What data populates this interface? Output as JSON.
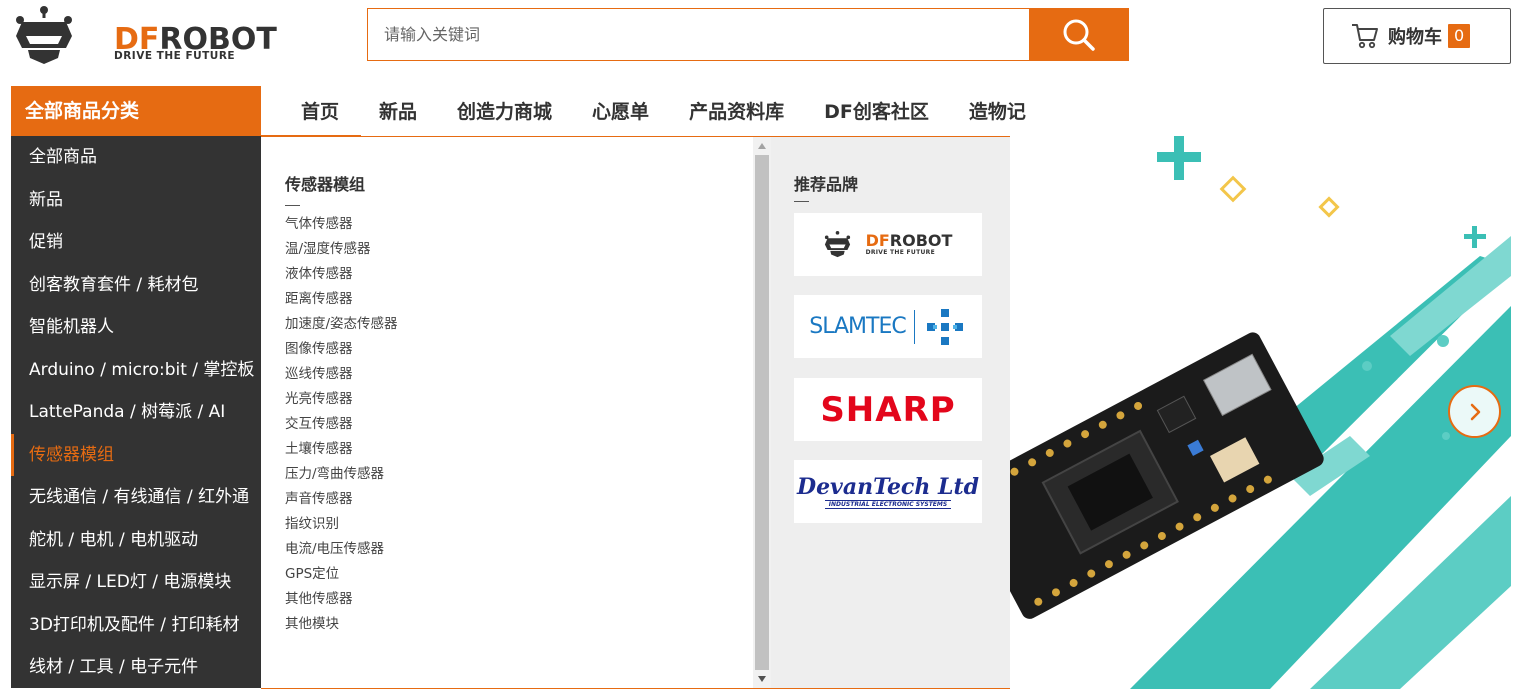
{
  "logo": {
    "brand_df": "DF",
    "brand_robot": "ROBOT",
    "tagline": "DRIVE THE FUTURE"
  },
  "search": {
    "placeholder": "请输入关键词"
  },
  "cart": {
    "label": "购物车",
    "count": "0"
  },
  "category_header": "全部商品分类",
  "nav": {
    "items": [
      "首页",
      "新品",
      "创造力商城",
      "心愿单",
      "产品资料库",
      "DF创客社区",
      "造物记"
    ]
  },
  "sidebar": {
    "items": [
      "全部商品",
      "新品",
      "促销",
      "创客教育套件 / 耗材包",
      "智能机器人",
      "Arduino / micro:bit / 掌控板",
      "LattePanda / 树莓派 / AI",
      "传感器模组",
      "无线通信 / 有线通信 / 红外通",
      "舵机 / 电机 / 电机驱动",
      "显示屏 / LED灯 / 电源模块",
      "3D打印机及配件 / 打印耗材",
      "线材 / 工具 / 电子元件"
    ],
    "active_index": 7
  },
  "mega_menu": {
    "title": "传感器模组",
    "links": [
      "气体传感器",
      "温/湿度传感器",
      "液体传感器",
      "距离传感器",
      "加速度/姿态传感器",
      "图像传感器",
      "巡线传感器",
      "光亮传感器",
      "交互传感器",
      "土壤传感器",
      "压力/弯曲传感器",
      "声音传感器",
      "指纹识别",
      "电流/电压传感器",
      "GPS定位",
      "其他传感器",
      "其他模块"
    ],
    "brands_title": "推荐品牌",
    "brands": [
      {
        "name_df": "DF",
        "name_robot": "ROBOT",
        "tagline": "DRIVE THE FUTURE"
      },
      {
        "name": "SLAMTEC"
      },
      {
        "name": "SHARP"
      },
      {
        "name": "DevanTech Ltd",
        "tagline": "INDUSTRIAL ELECTRONIC SYSTEMS"
      }
    ]
  },
  "colors": {
    "accent": "#e66b12",
    "sidebar_bg": "#333333",
    "banner_teal": "#3bbfb5",
    "brand_panel_bg": "#eeeeee"
  },
  "icons": {
    "search": "search-icon",
    "cart": "cart-icon",
    "next": "chevron-right-icon"
  }
}
